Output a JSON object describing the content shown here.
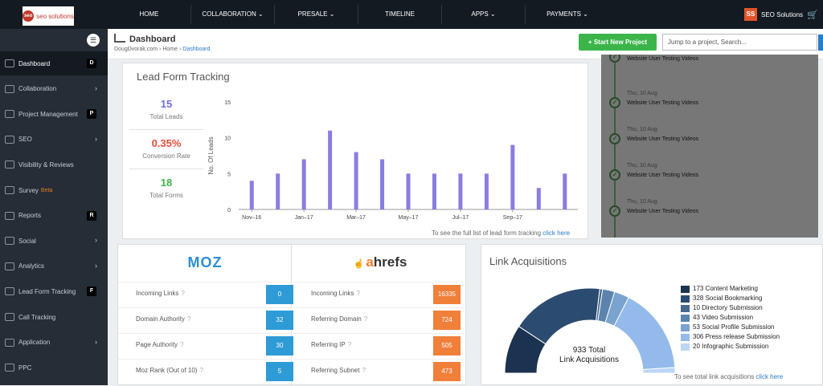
{
  "header": {
    "logo_text": "seo solutions",
    "nav": [
      {
        "label": "HOME"
      },
      {
        "label": "COLLABORATION ⌄"
      },
      {
        "label": "PRESALE ⌄"
      },
      {
        "label": "TIMELINE"
      },
      {
        "label": "APPS ⌄"
      },
      {
        "label": "PAYMENTS ⌄"
      }
    ],
    "brand_badge": "SS",
    "brand_name": "SEO Solutions",
    "cart_icon": "cart-icon"
  },
  "sidebar": {
    "items": [
      {
        "label": "Dashboard",
        "badge": "D",
        "icon": "monitor-icon"
      },
      {
        "label": "Collaboration",
        "chevron": "›",
        "icon": "users-icon"
      },
      {
        "label": "Project Management",
        "badge": "P",
        "icon": "calendar-icon"
      },
      {
        "label": "SEO",
        "chevron": "›",
        "icon": "seo-icon"
      },
      {
        "label": "Visibility & Reviews",
        "icon": "eye-icon"
      },
      {
        "label": "Survey",
        "beta": "Beta",
        "icon": "survey-icon"
      },
      {
        "label": "Reports",
        "badge": "R",
        "icon": "reports-icon"
      },
      {
        "label": "Social",
        "chevron": "›",
        "icon": "share-icon"
      },
      {
        "label": "Analytics",
        "chevron": "›",
        "icon": "analytics-icon"
      },
      {
        "label": "Lead Form Tracking",
        "badge": "F",
        "icon": "form-icon"
      },
      {
        "label": "Call Tracking",
        "icon": "phone-icon"
      },
      {
        "label": "Application",
        "chevron": "›",
        "icon": "app-icon"
      },
      {
        "label": "PPC",
        "icon": "ppc-icon"
      }
    ]
  },
  "page": {
    "title": "Dashboard",
    "breadcrumb": {
      "site": "DougDvorak.com",
      "sep": "›",
      "home": "Home",
      "current": "Dashboard"
    },
    "new_project": "+ Start New Project",
    "jump_placeholder": "Jump to a project, Search..."
  },
  "lead": {
    "title": "Lead Form Tracking",
    "kpis": [
      {
        "value": "15",
        "label": "Total Leads",
        "color": "#6c6cdc"
      },
      {
        "value": "0.35%",
        "label": "Conversion Rate",
        "color": "#e74c3c"
      },
      {
        "value": "18",
        "label": "Total Forms",
        "color": "#3bb54a"
      }
    ],
    "note": "To see the full list of lead form tracking",
    "note_link": "click here"
  },
  "chart_data": {
    "type": "bar",
    "ylabel": "No. Of Leads",
    "ylim": [
      0,
      15
    ],
    "yticks": [
      0,
      5,
      10,
      15
    ],
    "ticks": [
      {
        "label": "Nov–16",
        "pos": 0
      },
      {
        "label": "Jan–17",
        "pos": 2
      },
      {
        "label": "Mar–17",
        "pos": 4
      },
      {
        "label": "May–17",
        "pos": 6
      },
      {
        "label": "Jul–17",
        "pos": 8
      },
      {
        "label": "Sep–17",
        "pos": 10
      }
    ],
    "values": [
      4,
      5,
      7,
      11,
      8,
      7,
      5,
      5,
      5,
      5,
      9,
      3,
      5
    ],
    "color": "#8a7de0",
    "grid": false
  },
  "timeline": {
    "items": [
      {
        "date": "",
        "text": "Website User Testing Videos"
      },
      {
        "date": "Thu, 10 Aug",
        "text": "Website User Testing Videos"
      },
      {
        "date": "Thu, 10 Aug",
        "text": "Website User Testing Videos"
      },
      {
        "date": "Thu, 10 Aug",
        "text": "Website User Testing Videos"
      },
      {
        "date": "Thu, 10 Aug",
        "text": "Website User Testing Videos"
      }
    ]
  },
  "moz": {
    "logo": "MOZ",
    "rows": [
      {
        "label": "Incoming Links",
        "value": "0"
      },
      {
        "label": "Domain Authority",
        "value": "32"
      },
      {
        "label": "Page Authority",
        "value": "30"
      },
      {
        "label": "Moz Rank (Out of 10)",
        "value": "5"
      }
    ]
  },
  "ahrefs": {
    "logo_a": "a",
    "logo_rest": "hrefs",
    "rows": [
      {
        "label": "Incoming Links",
        "value": "16335"
      },
      {
        "label": "Referring Domain",
        "value": "724"
      },
      {
        "label": "Referring IP",
        "value": "505"
      },
      {
        "label": "Referring Subnet",
        "value": "473"
      }
    ]
  },
  "links": {
    "title": "Link Acquisitions",
    "total_line1": "933 Total",
    "total_line2": "Link Acquisitions",
    "segments": [
      {
        "label": "173 Content Marketing",
        "value": 173,
        "color": "#1b3350"
      },
      {
        "label": "328 Social Bookmarking",
        "value": 328,
        "color": "#2b4b70"
      },
      {
        "label": "10 Directory Submission",
        "value": 10,
        "color": "#46688f"
      },
      {
        "label": "43 Video Submission",
        "value": 43,
        "color": "#5c83ad"
      },
      {
        "label": "53 Social Profile Submission",
        "value": 53,
        "color": "#7aa3cf"
      },
      {
        "label": "306 Press release Submission",
        "value": 306,
        "color": "#93baea"
      },
      {
        "label": "20 Infographic Submission",
        "value": 20,
        "color": "#bcd6f5"
      }
    ],
    "note": "To see total link acquisitions",
    "note_link": "click here"
  }
}
